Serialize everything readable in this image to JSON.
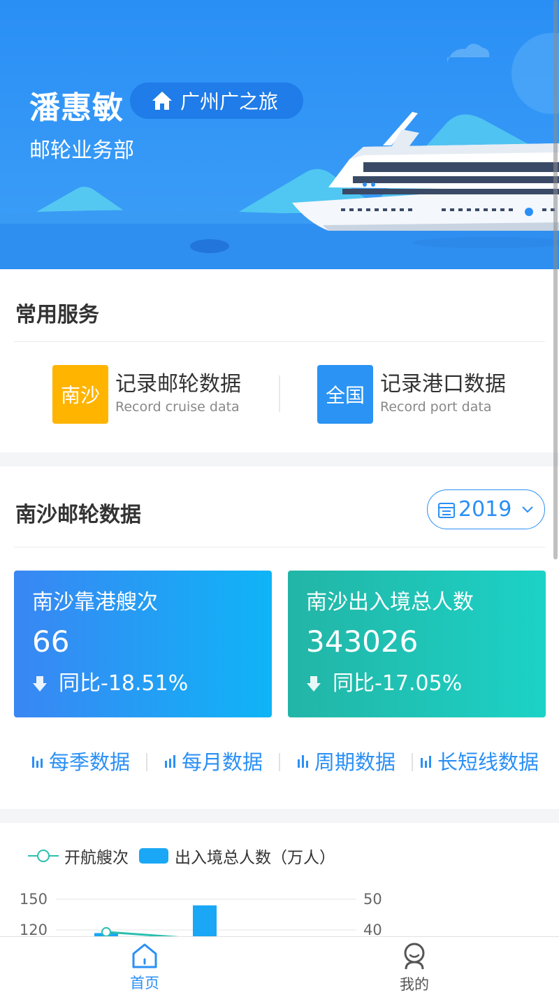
{
  "header": {
    "user_name": "潘惠敏",
    "company": "广州广之旅",
    "department": "邮轮业务部",
    "icons": {
      "company": "home-icon"
    }
  },
  "services": {
    "title": "常用服务",
    "items": [
      {
        "badge": "南沙",
        "title": "记录邮轮数据",
        "subtitle": "Record cruise data",
        "color": "#ffb400"
      },
      {
        "badge": "全国",
        "title": "记录港口数据",
        "subtitle": "Record port data",
        "color": "#2b93f3"
      }
    ]
  },
  "nansha": {
    "title": "南沙邮轮数据",
    "year": "2019",
    "icons": {
      "year": "calendar-icon",
      "dropdown": "chevron-down-icon"
    },
    "cards": [
      {
        "label": "南沙靠港艘次",
        "value": "66",
        "change": "同比-18.51%"
      },
      {
        "label": "南沙出入境总人数",
        "value": "343026",
        "change": "同比-17.05%"
      }
    ],
    "links": [
      "每季数据",
      "每月数据",
      "周期数据",
      "长短线数据"
    ]
  },
  "chart_data": {
    "type": "bar",
    "legend": [
      "开航艘次",
      "出入境总人数（万人）"
    ],
    "y_left_ticks": [
      "150",
      "120"
    ],
    "y_right_ticks": [
      "50",
      "40"
    ],
    "series": [
      {
        "name": "开航艘次",
        "type": "line",
        "values": [
          118,
          111
        ]
      },
      {
        "name": "出入境总人数（万人）",
        "type": "bar",
        "values": [
          39,
          48
        ]
      }
    ],
    "colors": {
      "line": "#2bbfb0",
      "bar": "#1aa7f5"
    }
  },
  "nav": {
    "items": [
      {
        "label": "首页",
        "icon": "home-icon",
        "active": true
      },
      {
        "label": "我的",
        "icon": "profile-icon",
        "active": false
      }
    ]
  },
  "colors": {
    "primary": "#2a8ff5",
    "active_nav": "#2a8ff5",
    "inactive_nav": "#555555"
  }
}
